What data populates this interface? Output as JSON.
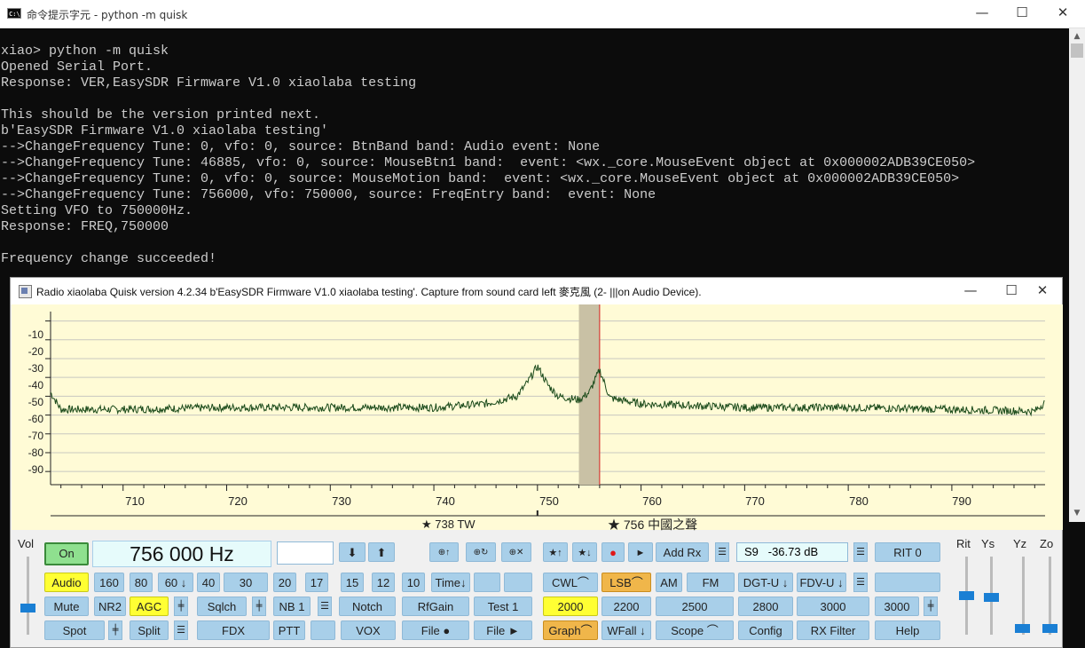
{
  "console": {
    "title": "命令提示字元 - python  -m quisk",
    "icon": "cmd-icon",
    "lines": [
      "xiao> python -m quisk",
      "Opened Serial Port.",
      "Response: VER,EasySDR Firmware V1.0 xiaolaba testing",
      "",
      "This should be the version printed next.",
      "b'EasySDR Firmware V1.0 xiaolaba testing'",
      "-->ChangeFrequency Tune: 0, vfo: 0, source: BtnBand band: Audio event: None",
      "-->ChangeFrequency Tune: 46885, vfo: 0, source: MouseBtn1 band:  event: <wx._core.MouseEvent object at 0x000002ADB39CE050>",
      "-->ChangeFrequency Tune: 0, vfo: 0, source: MouseMotion band:  event: <wx._core.MouseEvent object at 0x000002ADB39CE050>",
      "-->ChangeFrequency Tune: 756000, vfo: 750000, source: FreqEntry band:  event: None",
      "Setting VFO to 750000Hz.",
      "Response: FREQ,750000",
      "",
      "Frequency change succeeded!"
    ]
  },
  "quisk": {
    "title": "Radio xiaolaba   Quisk version 4.2.34   b'EasySDR Firmware V1.0 xiaolaba testing'. Capture from sound card left 麥克風 (2- |||on Audio Device).",
    "graph": {
      "bg_color": "#fffbd6",
      "trace_color": "#1a4a1a",
      "y_ticks": [
        "-10",
        "-20",
        "-30",
        "-40",
        "-50",
        "-60",
        "-70",
        "-80",
        "-90"
      ],
      "x_ticks": [
        "710",
        "720",
        "730",
        "740",
        "750",
        "760",
        "770",
        "780",
        "790"
      ],
      "station_labels": [
        "738 TW",
        "756 中國之聲"
      ]
    },
    "chart_data": {
      "type": "line",
      "xlabel": "",
      "ylabel": "",
      "xlim": [
        703,
        799
      ],
      "ylim": [
        -97,
        -5
      ],
      "x_unit": "kHz",
      "y_unit": "dB",
      "grid": true,
      "tuned_freq_khz": 756,
      "filter_passband_khz": [
        754,
        756
      ],
      "series": [
        {
          "x": [
            703,
            704,
            710,
            720,
            730,
            740,
            745,
            748,
            749,
            750,
            751,
            752,
            754,
            755,
            756,
            757,
            760,
            770,
            780,
            790,
            798,
            799
          ],
          "values": [
            -48,
            -57,
            -57,
            -56,
            -56,
            -56,
            -54,
            -50,
            -43,
            -34,
            -44,
            -50,
            -52,
            -48,
            -36,
            -51,
            -54,
            -56,
            -56,
            -57,
            -58,
            -53
          ]
        }
      ]
    },
    "controls": {
      "vol_label": "Vol",
      "rit_label": "Rit",
      "ys_label": "Ys",
      "yz_label": "Yz",
      "zo_label": "Zo",
      "on_label": "On",
      "frequency": "756 000 Hz",
      "freq_down": "⬇",
      "freq_up": "⬆",
      "mem_up": "⊕↑",
      "mem_recall": "⊕↻",
      "mem_clear": "⊕✕",
      "star_up": "★↑",
      "star_down": "★↓",
      "record": "●",
      "play": "►",
      "add_rx": "Add Rx",
      "smeter": "S9   -36.73 dB",
      "rit": "RIT 0",
      "row1": {
        "audio": "Audio",
        "b160": "160",
        "b80": "80",
        "b60": "60 ↓",
        "b40": "40",
        "b30": "30",
        "b20": "20",
        "b17": "17",
        "b15": "15",
        "b12": "12",
        "b10": "10",
        "time": "Time↓",
        "cwl": "CWL⌒",
        "lsb": "LSB⌒",
        "am": "AM",
        "fm": "FM",
        "dgtu": "DGT-U ↓",
        "fdvu": "FDV-U ↓"
      },
      "row2": {
        "mute": "Mute",
        "nr2": "NR2",
        "agc": "AGC",
        "sqlch": "Sqlch",
        "nb1": "NB 1",
        "notch": "Notch",
        "rfgain": "RfGain",
        "test1": "Test 1",
        "f2000a": "2000",
        "f2200": "2200",
        "f2500": "2500",
        "f2800": "2800",
        "f3000a": "3000",
        "f3000b": "3000"
      },
      "row3": {
        "spot": "Spot",
        "split": "Split",
        "fdx": "FDX",
        "ptt": "PTT",
        "vox": "VOX",
        "file1": "File ●",
        "file2": "File ►",
        "graph": "Graph⌒",
        "wfall": "WFall ↓",
        "scope": "Scope ⌒",
        "config": "Config",
        "rxfilter": "RX Filter",
        "help": "Help"
      }
    }
  }
}
